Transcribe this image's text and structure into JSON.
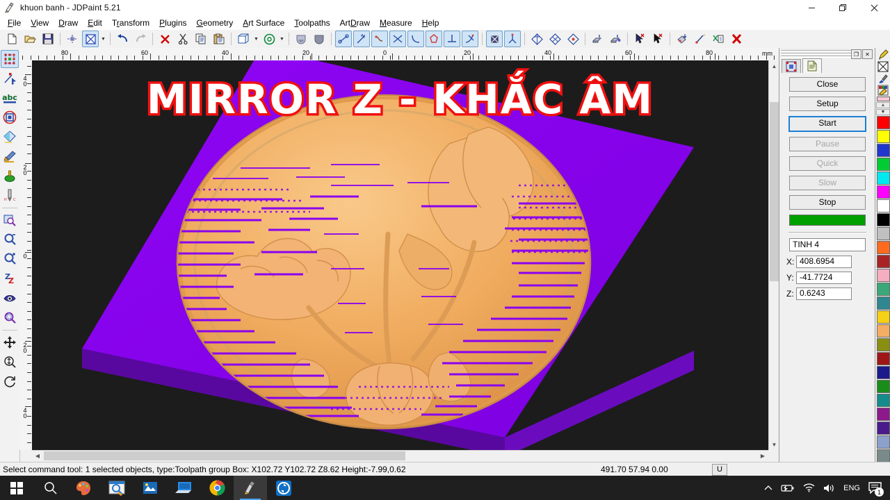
{
  "window": {
    "title": "khuon banh - JDPaint 5.21",
    "app_icon": "jdpaint-icon",
    "minimize": "—",
    "maximize": "❐",
    "close": "✕"
  },
  "menubar": {
    "items": [
      {
        "label": "File",
        "accel": "F"
      },
      {
        "label": "View",
        "accel": "V"
      },
      {
        "label": "Draw",
        "accel": "D"
      },
      {
        "label": "Edit",
        "accel": "E"
      },
      {
        "label": "Transform",
        "accel": "r"
      },
      {
        "label": "Plugins",
        "accel": "P"
      },
      {
        "label": "Geometry",
        "accel": "G"
      },
      {
        "label": "Art Surface",
        "accel": "A"
      },
      {
        "label": "Toolpaths",
        "accel": "T"
      },
      {
        "label": "ArtDraw",
        "accel": "D"
      },
      {
        "label": "Measure",
        "accel": "M"
      },
      {
        "label": "Help",
        "accel": "H"
      }
    ]
  },
  "toolbar": {
    "buttons": [
      {
        "name": "new-icon",
        "group": 0
      },
      {
        "name": "open-icon",
        "group": 0
      },
      {
        "name": "save-icon",
        "group": 0
      },
      {
        "name": "crosshair-icon",
        "group": 1
      },
      {
        "name": "select-all-icon",
        "group": 1,
        "selected": true
      },
      {
        "name": "undo-icon",
        "group": 2
      },
      {
        "name": "redo-icon",
        "group": 2
      },
      {
        "name": "delete-icon",
        "group": 3
      },
      {
        "name": "cut-icon",
        "group": 3
      },
      {
        "name": "copy-icon",
        "group": 3
      },
      {
        "name": "paste-icon",
        "group": 3
      },
      {
        "name": "box-3d-icon",
        "group": 4
      },
      {
        "name": "rotate-view-icon",
        "group": 4
      },
      {
        "name": "shade-light-icon",
        "group": 5
      },
      {
        "name": "shade-dark-icon",
        "group": 5
      },
      {
        "name": "line-icon",
        "group": 6,
        "selected": true
      },
      {
        "name": "arrow-node-icon",
        "group": 6,
        "selected": true
      },
      {
        "name": "curve-icon",
        "group": 6,
        "selected": true
      },
      {
        "name": "intersect-icon",
        "group": 6,
        "selected": true
      },
      {
        "name": "arc-icon",
        "group": 6,
        "selected": true
      },
      {
        "name": "polygon-icon",
        "group": 6,
        "selected": true
      },
      {
        "name": "perpendicular-icon",
        "group": 6,
        "selected": true
      },
      {
        "name": "tangent-icon",
        "group": 6,
        "selected": true
      },
      {
        "name": "node-edit-icon",
        "group": 7,
        "selected": true
      },
      {
        "name": "path-edit-icon",
        "group": 7,
        "selected": true
      },
      {
        "name": "surface-a-icon",
        "group": 8
      },
      {
        "name": "surface-b-icon",
        "group": 8
      },
      {
        "name": "surface-c-icon",
        "group": 8
      },
      {
        "name": "relief-low-icon",
        "group": 9
      },
      {
        "name": "relief-high-icon",
        "group": 9
      },
      {
        "name": "pick-add-icon",
        "group": 10
      },
      {
        "name": "pick-remove-icon",
        "group": 10
      },
      {
        "name": "toolpath-down-icon",
        "group": 11
      },
      {
        "name": "toolpath-edit-icon",
        "group": 11
      },
      {
        "name": "toolpath-delete-icon",
        "group": 11
      },
      {
        "name": "close-red-icon",
        "group": 12
      }
    ]
  },
  "lefttools": {
    "buttons": [
      {
        "name": "select-object-icon",
        "selected": true
      },
      {
        "name": "node-select-icon"
      },
      {
        "name": "text-abc-icon"
      },
      {
        "name": "shape-ring-icon"
      },
      {
        "name": "gradient-fill-icon"
      },
      {
        "name": "art-brush-icon"
      },
      {
        "name": "relief-drop-icon"
      },
      {
        "name": "endmill-tool-icon"
      },
      {
        "name": "zoom-window-icon",
        "sep_before": true
      },
      {
        "name": "zoom-out-icon"
      },
      {
        "name": "zoom-in-icon"
      },
      {
        "name": "zoom-prev-icon"
      },
      {
        "name": "view-eye-icon"
      },
      {
        "name": "zoom-object-icon"
      },
      {
        "name": "pan-move-icon",
        "sep_before": true
      },
      {
        "name": "zoom-dynamic-icon"
      },
      {
        "name": "rotate-3d-icon"
      }
    ]
  },
  "rulers": {
    "unit": "mm",
    "horizontal_labels": [
      "80",
      "60",
      "40",
      "20",
      "0",
      "20",
      "40",
      "60",
      "80"
    ],
    "vertical_labels": [
      "40",
      "20",
      "0",
      "20",
      "40"
    ]
  },
  "canvas": {
    "background": "#1c1c1c",
    "slab_color": "#8a00f0",
    "slab_side_color": "#5c0aa8",
    "relief_color": "#f0ab5e",
    "overlay_text": "MIRROR Z - KHẮC ÂM",
    "overlay_fill": "#ffffff",
    "overlay_stroke": "#f01010"
  },
  "rightpanel": {
    "tabs": [
      {
        "name": "tab-simulation",
        "active": false
      },
      {
        "name": "tab-document",
        "active": true
      }
    ],
    "restore_label": "❐",
    "close_label": "✕",
    "buttons": [
      {
        "label": "Close",
        "state": "normal",
        "name": "close-button"
      },
      {
        "label": "Setup",
        "state": "normal",
        "name": "setup-button"
      },
      {
        "label": "Start",
        "state": "focus",
        "name": "start-button"
      },
      {
        "label": "Pause",
        "state": "disabled",
        "name": "pause-button"
      },
      {
        "label": "Quick",
        "state": "disabled",
        "name": "quick-button"
      },
      {
        "label": "Slow",
        "state": "disabled",
        "name": "slow-button"
      },
      {
        "label": "Stop",
        "state": "normal",
        "name": "stop-button"
      }
    ],
    "progress_color": "#00a000",
    "progress_value": 100,
    "toolpath_name": "TINH 4",
    "coords": [
      {
        "axis": "X:",
        "value": "408.6954"
      },
      {
        "axis": "Y:",
        "value": "-41.7724"
      },
      {
        "axis": "Z:",
        "value": "0.6243"
      }
    ]
  },
  "palette": {
    "tools": [
      {
        "name": "pencil-icon"
      },
      {
        "name": "no-fill-icon"
      },
      {
        "name": "eyedropper-icon"
      },
      {
        "name": "palette-edit-icon"
      }
    ],
    "current_color": "#f8c8d4",
    "scroll_up": "▲",
    "scroll_down": "▼",
    "swatches": [
      "#ff0000",
      "#ffff00",
      "#2038d0",
      "#00cc33",
      "#00e8f0",
      "#ff00ff",
      "#ffffff",
      "#000000",
      "#c0c0c0",
      "#ff6a1f",
      "#a82424",
      "#f4aec0",
      "#3aa878",
      "#2f8890",
      "#f5d014",
      "#f4ad64",
      "#8a8f12",
      "#9e1616",
      "#1a1a8c",
      "#1a8c1a",
      "#148c8c",
      "#8c1a8c",
      "#4a1a8c",
      "#8ca0cc",
      "#7a8a8a"
    ]
  },
  "statusbar": {
    "message": "Select command tool: 1 selected objects, type:Toolpath group Box: X102.72 Y102.72 Z8.62 Height:-7.99,0.62",
    "coords": "491.70 57.94 0.00",
    "unit_toggle": "U"
  },
  "taskbar": {
    "items": [
      {
        "name": "start-button-icon"
      },
      {
        "name": "search-icon"
      },
      {
        "name": "paint-icon"
      },
      {
        "name": "file-explorer-search-icon"
      },
      {
        "name": "powerpoint-icon"
      },
      {
        "name": "remote-desktop-icon"
      },
      {
        "name": "chrome-icon"
      },
      {
        "name": "jdpaint-icon",
        "active": true
      },
      {
        "name": "teamviewer-icon"
      }
    ],
    "tray": [
      {
        "name": "show-hidden-icons",
        "glyph": "⌃"
      },
      {
        "name": "battery-icon",
        "glyph": "▭"
      },
      {
        "name": "wifi-icon",
        "glyph": "◠"
      },
      {
        "name": "volume-icon",
        "glyph": "◁"
      },
      {
        "name": "language-indicator",
        "glyph": "ENG"
      },
      {
        "name": "notifications-icon",
        "glyph": "❐",
        "badge": "1"
      }
    ]
  }
}
